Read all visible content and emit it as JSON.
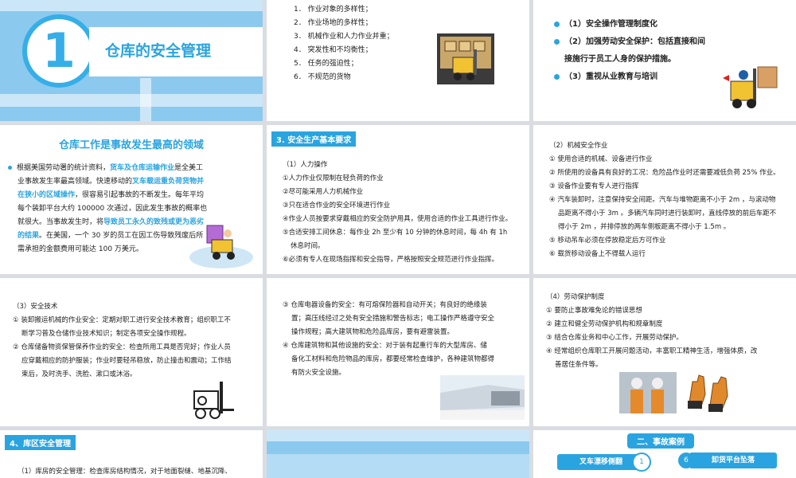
{
  "slide1": {
    "number": "1",
    "title": "仓库的安全管理"
  },
  "slide2": {
    "items": [
      "1． 作业对象的多样性；",
      "2． 作业场地的多样性；",
      "3． 机械作业和人力作业并重；",
      "4． 突发性和不均衡性；",
      "5． 任务的强迫性；",
      "6． 不规范的货物"
    ]
  },
  "slide3": {
    "items": [
      "（1）安全操作管理制度化",
      "（2）加强劳动安全保护：包括直接和间",
      "接施行于员工人身的保护措施。",
      "（3）重视从业教育与培训"
    ]
  },
  "slide4": {
    "title": "仓库工作是事故发生最高的领域",
    "lines": [
      [
        "根据美国劳动署的统计资料，",
        "货车及仓库运输作业",
        "是全美工"
      ],
      [
        "业事故发生率最高领域。快速移动的",
        "叉车载运重负荷货物并",
        ""
      ],
      [
        "",
        "在狭小的区域操作",
        "，很容易引起事故的不断发生。每年平均"
      ],
      [
        "每个装卸平台大约 100000 次通过，因此发生事故的概率也",
        "",
        ""
      ],
      [
        "就很大。当事故发生时，将",
        "导致员工永久的致残或更为恶劣",
        ""
      ],
      [
        "",
        "的结果",
        "。在美国，一个 30 岁的员工在因工伤导致残废后所"
      ],
      [
        "需承担的金额费用可能达 100 万美元。",
        "",
        ""
      ]
    ]
  },
  "slide5": {
    "tag": "3. 安全生产基本要求",
    "heading": "（1）人力操作",
    "items": [
      "①人力作业仅限制在轻负荷的作业",
      "②尽可能采用人力机械作业",
      "③只在适合作业的安全环境进行作业",
      "④作业人员按要求穿戴相应的安全防护用具，使用合适的作业工具进行作业。",
      "⑤合适安排工间休息：每作业 2h 至少有 10 分钟的休息时间，每 4h 有 1h",
      "休息时间。",
      "⑥必须有专人在现场指挥和安全指导，严格按照安全规范进行作业指挥。"
    ]
  },
  "slide6": {
    "heading": "（2）机械安全作业",
    "items": [
      "① 使用合适的机械、设备进行作业",
      "② 所使用的设备具有良好的工况：危险品作业时还需要减低负荷 25% 作业。",
      "③ 设备作业要有专人进行指挥",
      "④ 汽车装卸时，注意保持安全间距。汽车与堆物距离不小于 2m ，与滚动物",
      "品距离不得小于 3m 。多辆汽车同时进行装卸时，直线停放的前后车距不",
      "得小于 2m ，并排停放的两车侧板距离不得小于 1.5m 。",
      "⑤ 移动吊车必须在停放稳定后方可作业",
      "⑥ 载货移动设备上不得载人运行"
    ]
  },
  "slide7": {
    "heading": "（3）安全技术",
    "items": [
      "① 装卸搬运机械的作业安全：定期对职工进行安全技术教育；组织职工不",
      "断学习普及仓储作业技术知识；制定各项安全操作规程。",
      "② 仓库储备物资保管保养作业的安全：检查所用工具是否完好；作业人员",
      "应穿戴相应的防护服装；作业时要轻吊稳放，防止撞击和震动；工作结",
      "束后，及时洗手、洗脸、漱口或沐浴。"
    ]
  },
  "slide8": {
    "items": [
      "③ 仓库电器设备的安全：有可熔保险器和自动开关；有良好的绝缘装",
      "置；高压线经过之处有安全措施和警告标志；电工操作严格遵守安全",
      "操作规程；高大建筑物和危险品库房，要有避雷装置。",
      "④ 仓库建筑物和其他设施的安全：对于装有起重行车的大型库房、储",
      "备化工材料和危险物品的库房，都要经常检查维护，各种建筑物都得",
      "有防火安全设施。"
    ]
  },
  "slide9": {
    "heading": "（4）劳动保护制度",
    "items": [
      "① 要防止事故难免论的错误思想",
      "② 建立和健全劳动保护机构和规章制度",
      "③ 结合仓库业务和中心工作，开展劳动保护。",
      "④ 经常组织仓库职工开展问题活动，丰富职工精神生活，增强体质，改",
      "善居住条件等。"
    ]
  },
  "slide10": {
    "tag": "4、库区安全管理",
    "text": "（1）库房的安全管理：检查库房结构情况，对于地面裂缝、地基沉降、"
  },
  "slide12": {
    "title": "二、事故案例",
    "left_label": "叉车漂移侧翻",
    "left_num": "1",
    "right_num": "6",
    "right_label": "卸货平台坠落"
  },
  "colors": {
    "accent": "#2aa4e0",
    "light_blue": "#8cc9ee"
  }
}
